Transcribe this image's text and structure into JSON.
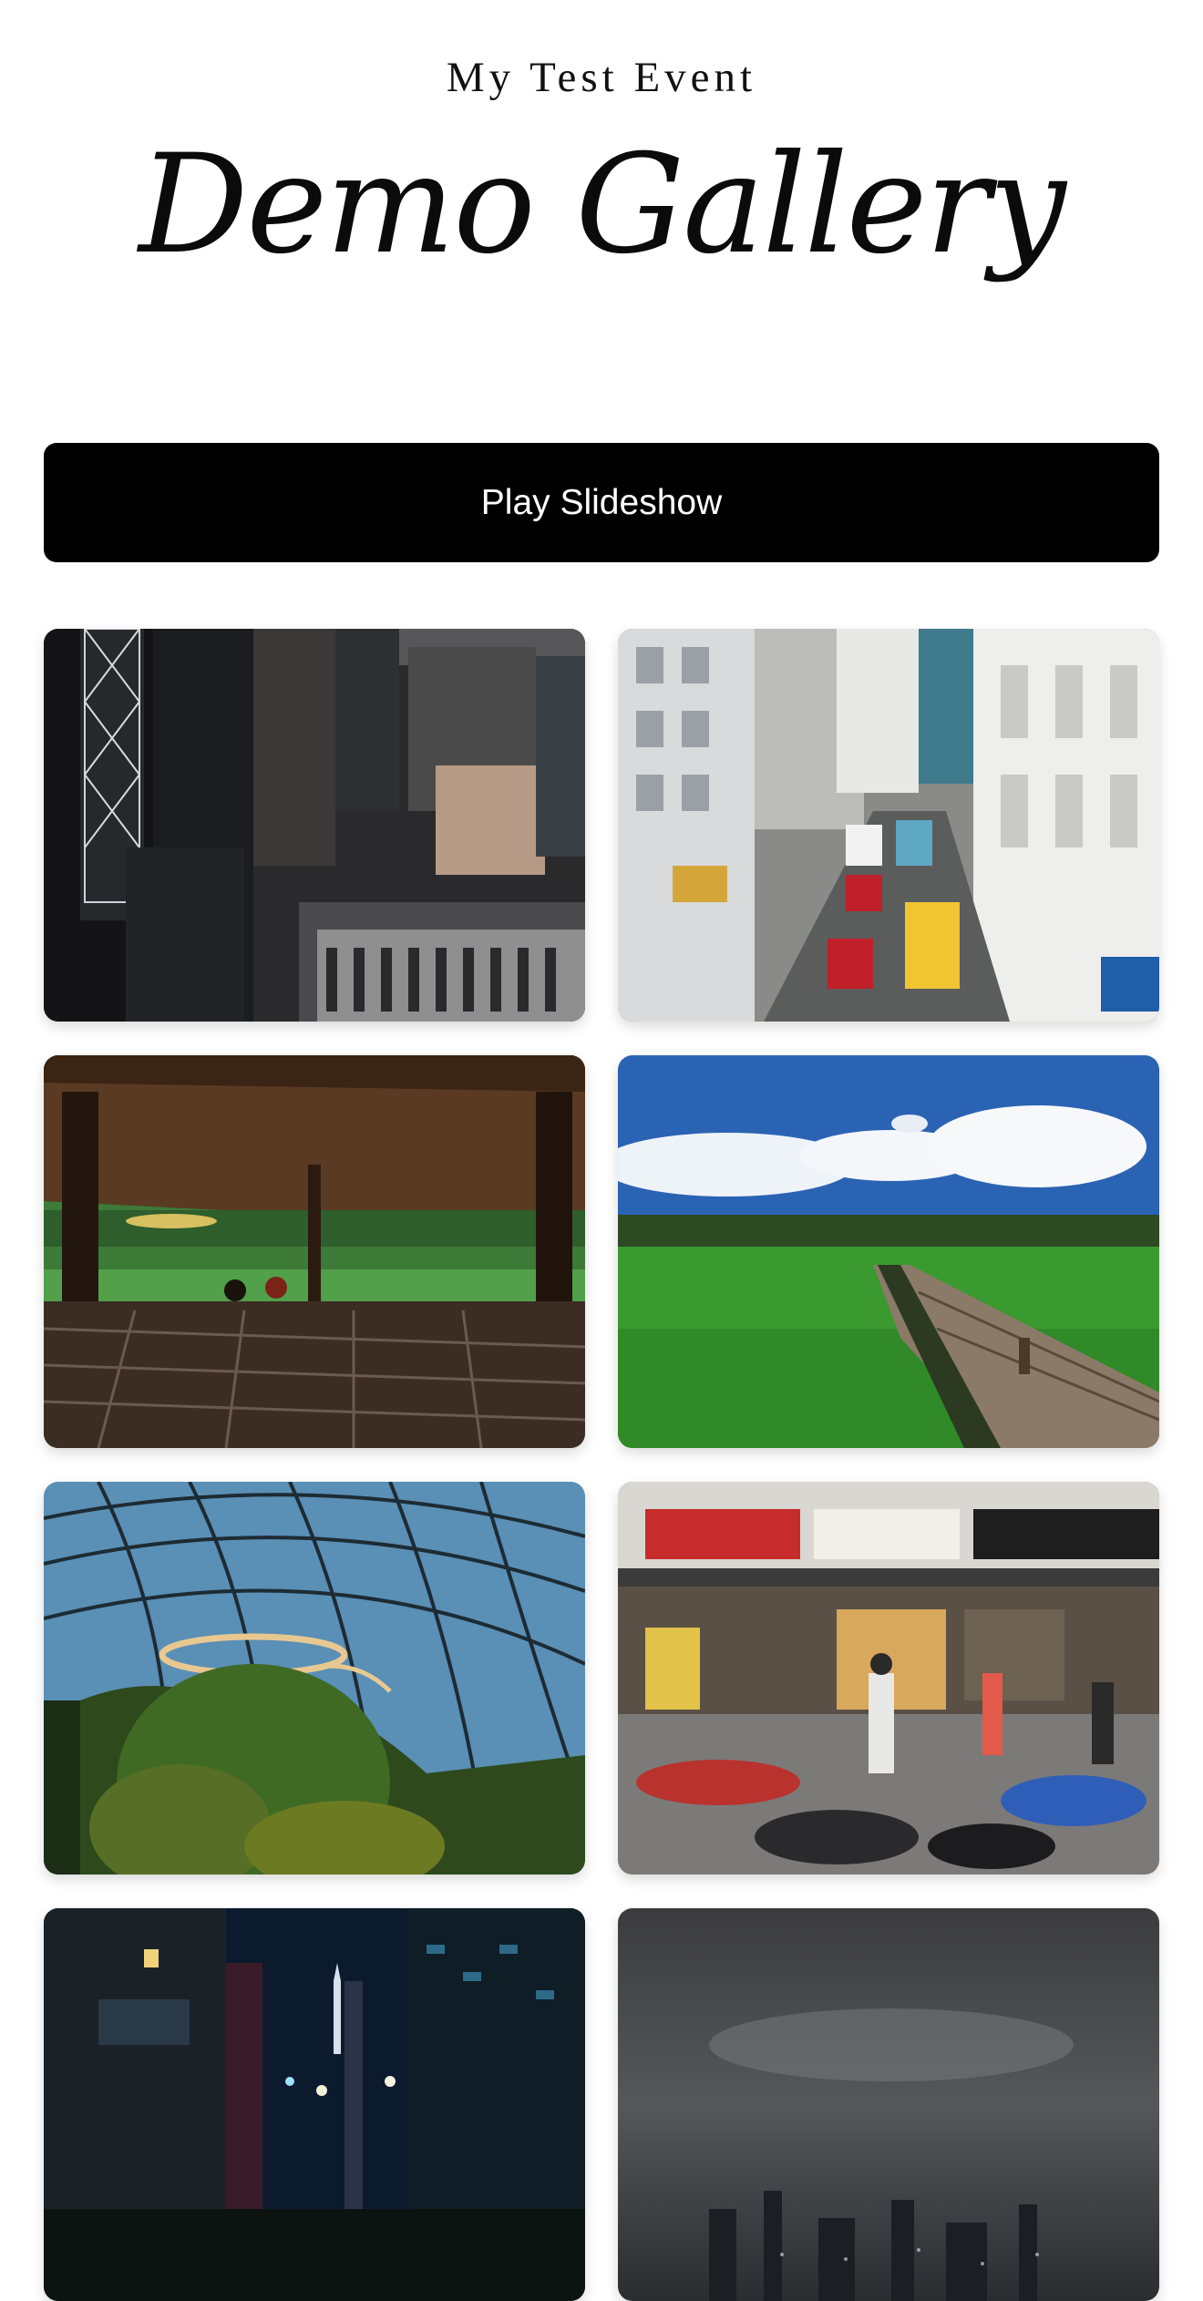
{
  "header": {
    "event_title": "My Test Event",
    "gallery_title": "Demo Gallery"
  },
  "actions": {
    "play_slideshow_label": "Play Slideshow"
  },
  "gallery": {
    "photos": [
      {
        "subject": "city-skyscrapers"
      },
      {
        "subject": "busy-street-traffic"
      },
      {
        "subject": "thatched-pavilion-rice-field"
      },
      {
        "subject": "rice-field-wooden-walkway"
      },
      {
        "subject": "glass-dome-garden"
      },
      {
        "subject": "street-storefronts-scooters"
      },
      {
        "subject": "night-city-avenue"
      },
      {
        "subject": "misty-night-skyline"
      }
    ]
  }
}
